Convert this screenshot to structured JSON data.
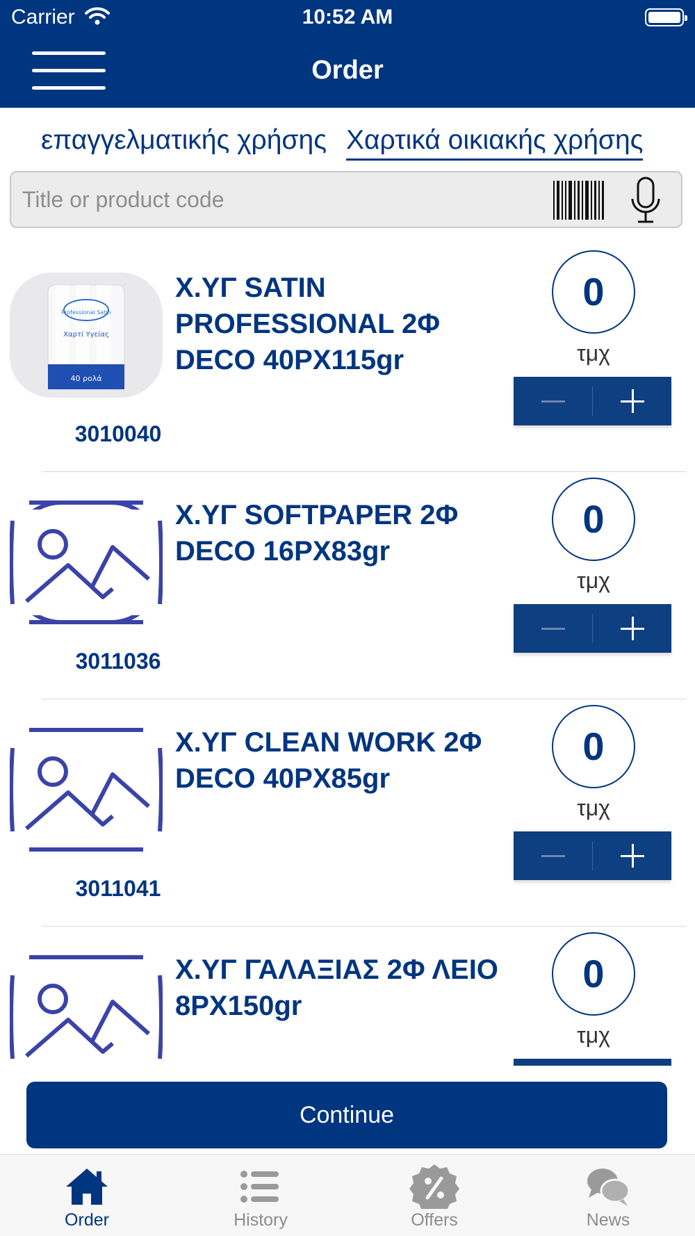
{
  "status_bar": {
    "carrier": "Carrier",
    "time": "10:52 AM"
  },
  "header": {
    "title": "Order",
    "menu_icon": "hamburger-menu-icon"
  },
  "categories": [
    {
      "label": "επαγγελματικής χρήσης",
      "selected": false
    },
    {
      "label": "Χαρτικά οικιακής χρήσης",
      "selected": true
    }
  ],
  "search": {
    "placeholder": "Title or product code",
    "value": "",
    "icons": [
      "barcode-icon",
      "microphone-icon"
    ]
  },
  "products": [
    {
      "name": "Χ.ΥΓ SATIN PROFESSIONAL 2Φ DECO 40PX115gr",
      "code": "3010040",
      "quantity": "0",
      "unit": "τμχ",
      "image": "product-photo",
      "image_text": [
        "Professional Satin",
        "Χαρτί Υγείας",
        "40 ρολά"
      ]
    },
    {
      "name": "Χ.ΥΓ SOFTPAPER 2Φ DECO 16PX83gr",
      "code": "3011036",
      "quantity": "0",
      "unit": "τμχ",
      "image": "image-placeholder-icon"
    },
    {
      "name": "Χ.ΥΓ CLEAN WORK 2Φ DECO 40PX85gr",
      "code": "3011041",
      "quantity": "0",
      "unit": "τμχ",
      "image": "image-placeholder-icon"
    },
    {
      "name": "Χ.ΥΓ ΓΑΛΑΞΙΑΣ 2Φ ΛΕΙΟ 8PX150gr",
      "code": "",
      "quantity": "0",
      "unit": "τμχ",
      "image": "image-placeholder-icon"
    }
  ],
  "continue_button": {
    "label": "Continue"
  },
  "tab_bar": [
    {
      "label": "Order",
      "icon": "home-icon",
      "active": true
    },
    {
      "label": "History",
      "icon": "list-icon",
      "active": false
    },
    {
      "label": "Offers",
      "icon": "percent-badge-icon",
      "active": false
    },
    {
      "label": "News",
      "icon": "chat-bubbles-icon",
      "active": false
    }
  ],
  "colors": {
    "primary": "#003580",
    "stepper": "#0e3f80",
    "placeholder_icon": "#3a43a8",
    "tab_inactive": "#8c8c8c"
  }
}
